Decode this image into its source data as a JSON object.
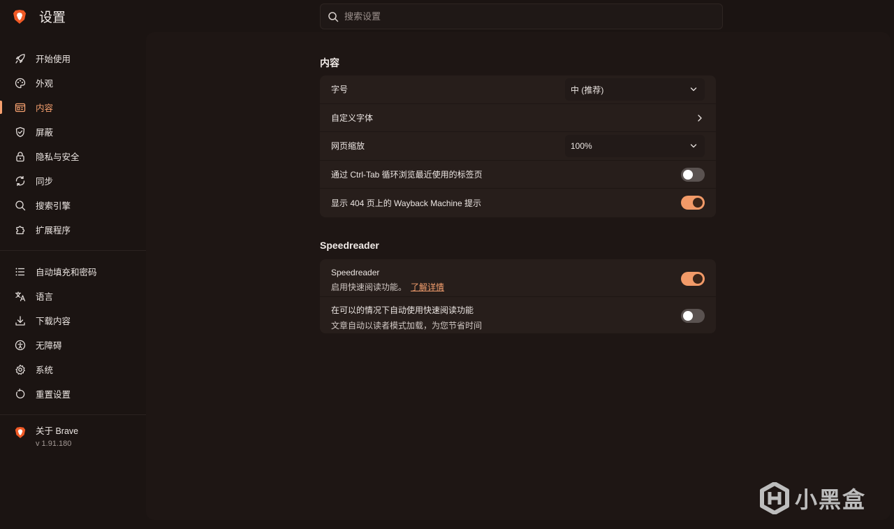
{
  "header": {
    "title": "设置",
    "search_placeholder": "搜索设置"
  },
  "sidebar": {
    "group1": [
      {
        "label": "开始使用",
        "icon": "rocket-icon"
      },
      {
        "label": "外观",
        "icon": "palette-icon"
      },
      {
        "label": "内容",
        "icon": "content-icon",
        "active": true
      },
      {
        "label": "屏蔽",
        "icon": "shield-icon"
      },
      {
        "label": "隐私与安全",
        "icon": "lock-icon"
      },
      {
        "label": "同步",
        "icon": "sync-icon"
      },
      {
        "label": "搜索引擎",
        "icon": "search-icon"
      },
      {
        "label": "扩展程序",
        "icon": "puzzle-icon"
      }
    ],
    "group2": [
      {
        "label": "自动填充和密码",
        "icon": "list-icon"
      },
      {
        "label": "语言",
        "icon": "translate-icon"
      },
      {
        "label": "下载内容",
        "icon": "download-icon"
      },
      {
        "label": "无障碍",
        "icon": "accessibility-icon"
      },
      {
        "label": "系统",
        "icon": "gear-icon"
      },
      {
        "label": "重置设置",
        "icon": "reset-icon"
      }
    ],
    "about": {
      "name": "关于 Brave",
      "version": "v 1.91.180"
    }
  },
  "content_section": {
    "title": "内容",
    "font_size": {
      "label": "字号",
      "value": "中 (推荐)"
    },
    "custom_fonts": {
      "label": "自定义字体"
    },
    "page_zoom": {
      "label": "网页缩放",
      "value": "100%"
    },
    "ctrl_tab": {
      "label": "通过 Ctrl-Tab 循环浏览最近使用的标签页",
      "enabled": false
    },
    "wayback": {
      "label": "显示 404 页上的 Wayback Machine 提示",
      "enabled": true
    }
  },
  "speedreader_section": {
    "title": "Speedreader",
    "speedreader": {
      "label": "Speedreader",
      "description": "启用快速阅读功能。",
      "link": "了解详情",
      "enabled": true
    },
    "auto": {
      "label": "在可以的情况下自动使用快速阅读功能",
      "description": "文章自动以读者模式加载，为您节省时间",
      "enabled": false
    }
  },
  "watermark": {
    "text": "小黑盒"
  },
  "colors": {
    "accent": "#f6a06f",
    "background": "#1b1412",
    "panel": "#1e1614",
    "card": "#271e1b"
  }
}
